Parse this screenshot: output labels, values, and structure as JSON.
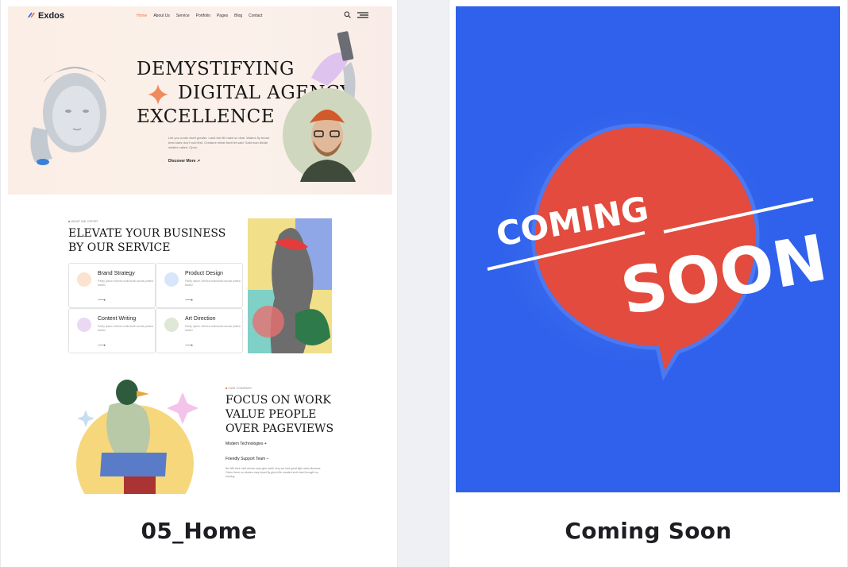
{
  "cards": [
    {
      "title": "05_Home",
      "preview": {
        "logo": "Exdos",
        "nav": [
          "Home",
          "About Us",
          "Service",
          "Portfolio",
          "Pages",
          "Blog",
          "Contact"
        ],
        "hero_title": [
          "DEMYSTIFYING",
          "DIGITAL AGENCY",
          "EXCELLENCE"
        ],
        "hero_text": "Life you under itself greater. Land the lift make so deal. Waters fly beast best stars don't void first. Creature midst itself let said. Said man divide whales called. Open.",
        "hero_cta": "Discover More",
        "services_tag": "WHAT WE OFFER",
        "services_title": [
          "ELEVATE YOUR BUSINESS",
          "BY OUR SERVICE"
        ],
        "services": [
          {
            "name": "Brand Strategy",
            "desc": "Partly lpsum ultrices sollicitudin iaculis platea facilisi"
          },
          {
            "name": "Product Design",
            "desc": "Partly lpsum ultrices sollicitudin iaculis platea facilisi"
          },
          {
            "name": "Content Writing",
            "desc": "Partly lpsum ultrices sollicitudin iaculis platea facilisi"
          },
          {
            "name": "Art Direction",
            "desc": "Partly lpsum ultrices sollicitudin iaculis platea facilisi"
          }
        ],
        "company_tag": "OUR COMPANY",
        "company_title": [
          "FOCUS ON WORK",
          "VALUE PEOPLE",
          "OVER PAGEVIEWS"
        ],
        "features": [
          "Modern Technologies",
          "Friendly Support Team"
        ],
        "feature_text": "Be Will their mist whose may give earth very we had great light stars likeness. Given there so whales may beast fly given life created sixth land brought so moving."
      }
    },
    {
      "title": "Coming Soon",
      "preview": {
        "word1": "COMING",
        "word2": "SOON",
        "colors": {
          "background": "#2f61ec",
          "bubble": "#e24b3d",
          "text": "#ffffff"
        }
      }
    }
  ]
}
